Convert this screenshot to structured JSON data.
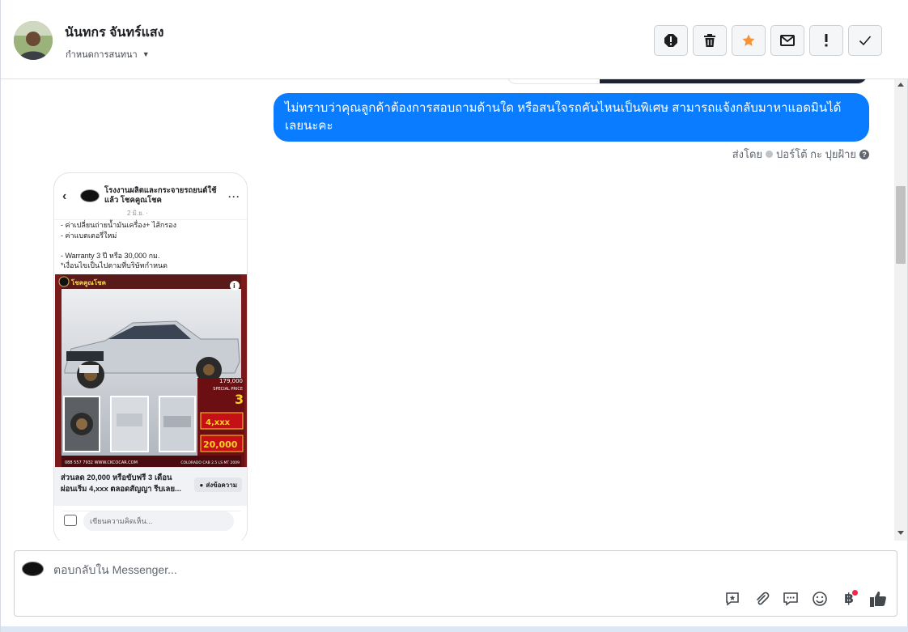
{
  "header": {
    "contact_name": "นันทกร จันทร์แสง",
    "assign_label": "กำหนดการสนทนา",
    "actions": [
      {
        "icon": "alert-circle-icon"
      },
      {
        "icon": "trash-icon"
      },
      {
        "icon": "star-icon",
        "color": "#f7923b"
      },
      {
        "icon": "envelope-icon"
      },
      {
        "icon": "exclamation-icon"
      },
      {
        "icon": "checkmark-icon"
      }
    ]
  },
  "thread": {
    "outgoing_message": "ไม่ทราบว่าคุณลูกค้าต้องการสอบถามด้านใด หรือสนใจรถคันไหนเป็นพิเศษ สามารถแจ้งกลับมาหาแอดมินได้เลยนะคะ",
    "sent_by_label": "ส่งโดย",
    "sender_name": "ปอร์โต้ กะ ปุยฝ้าย",
    "bubble_color": "#0a7cff"
  },
  "shared_post": {
    "page_name": "โรงงานผลิตและกระจายรถยนต์ใช้แล้ว โชคคูณโชค",
    "date": "2 มิ.ย. ·",
    "lines": [
      "- ค่าเปลี่ยนถ่ายน้ำมันเครื่อง+ ไส้กรอง",
      "- ค่าแบตเตอรี่ใหม่",
      "",
      "- Warranty 3 ปี หรือ 30,000 กม.",
      "*เงื่อนไขเป็นไปตามที่บริษัทกำหนด"
    ],
    "ad_brand": "โชคคูณโชค",
    "ad_price": "179,000",
    "ad_special": "SPECIAL PRICE",
    "ad_installment": "4,xxx",
    "ad_discount": "20,000",
    "ad_years": "3",
    "ad_phone": "088 557 7932 WWW.CKCOCAR.COM",
    "ad_model": "COLORADO CAB 2.5 LS MT 2009",
    "caption_line1": "ส่วนลด 20,000 หรือขับฟรี 3 เดือน",
    "caption_line2": "ผ่อนเริ่ม 4,xxx ตลอดสัญญา รีบเลย...",
    "send_button": "ส่งข้อความ",
    "comment_placeholder": "เขียนความคิดเห็น..."
  },
  "composer": {
    "placeholder": "ตอบกลับใน Messenger...",
    "tools": [
      "feedback-icon",
      "paperclip-icon",
      "quick-reply-icon",
      "emoji-icon",
      "baht-icon",
      "thumbs-up-icon"
    ]
  }
}
